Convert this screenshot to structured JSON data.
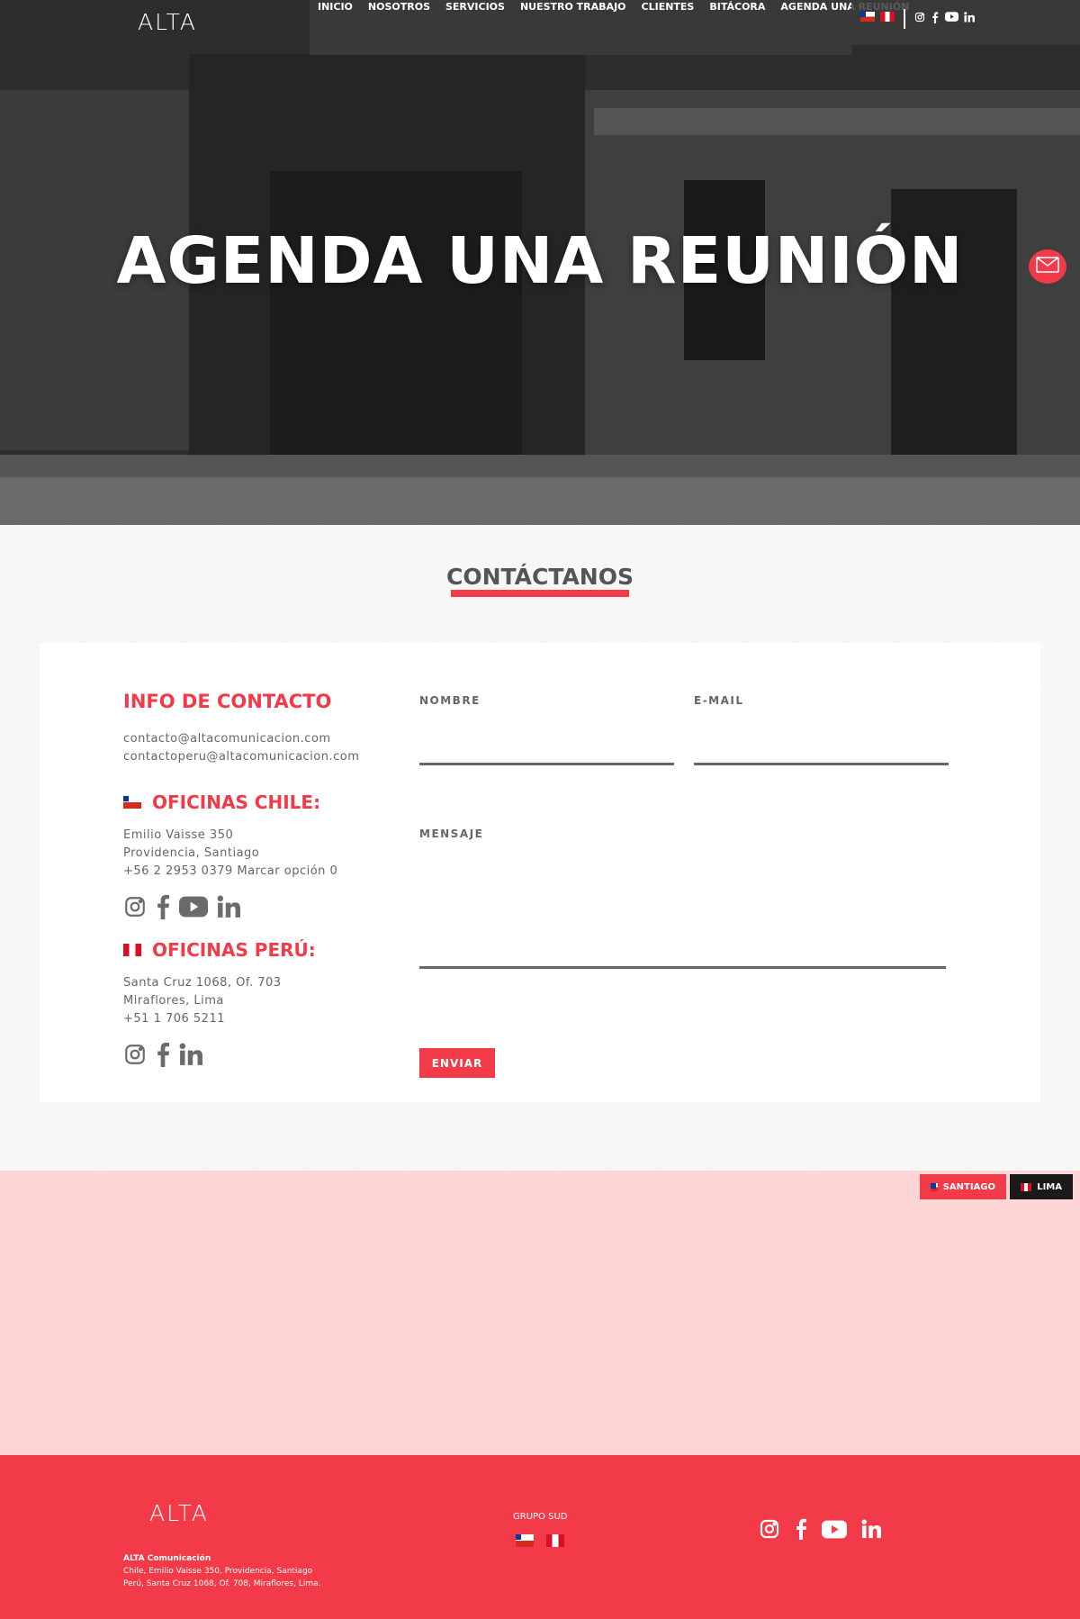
{
  "brand": {
    "logo": "ALTA",
    "accent_color": "#f23a48"
  },
  "nav": {
    "items": [
      "INICIO",
      "NOSOTROS",
      "SERVICIOS",
      "NUESTRO TRABAJO",
      "CLIENTES",
      "BITÁCORA",
      "AGENDA UNA REUNIÓN"
    ]
  },
  "topbar": {
    "flags": [
      "chile-flag-icon",
      "peru-flag-icon"
    ],
    "social_icons": [
      "instagram-icon",
      "facebook-icon",
      "youtube-icon",
      "linkedin-icon"
    ]
  },
  "hero": {
    "title": "AGENDA UNA REUNIÓN"
  },
  "contact": {
    "section_title": "CONTÁCTANOS",
    "info_title": "INFO DE CONTACTO",
    "emails": [
      "contacto@altacomunicacion.com",
      "contactoperu@altacomunicacion.com"
    ],
    "chile": {
      "title": "OFICINAS CHILE:",
      "lines": [
        "Emilio Vaisse 350",
        "Providencia, Santiago",
        "+56 2 2953 0379 Marcar opción 0"
      ]
    },
    "peru": {
      "title": "OFICINAS PERÚ:",
      "lines": [
        "Santa Cruz 1068, Of. 703",
        "Miraflores, Lima",
        "+51 1 706 5211"
      ]
    },
    "form": {
      "name_label": "NOMBRE",
      "email_label": "E-MAIL",
      "message_label": "MENSAJE",
      "name_value": "",
      "email_value": "",
      "message_value": "",
      "submit_label": "ENVIAR"
    }
  },
  "map": {
    "santiago_label": "SANTIAGO",
    "lima_label": "LIMA"
  },
  "footer": {
    "logo": "ALTA",
    "company": "ALTA Comunicación",
    "address_lines": [
      "Chile, Emilio Vaisse 350, Providencia, Santiago",
      "Perú, Santa Cruz 1068, Of. 708, Miraflores, Lima."
    ],
    "group_label": "GRUPO SUD"
  }
}
